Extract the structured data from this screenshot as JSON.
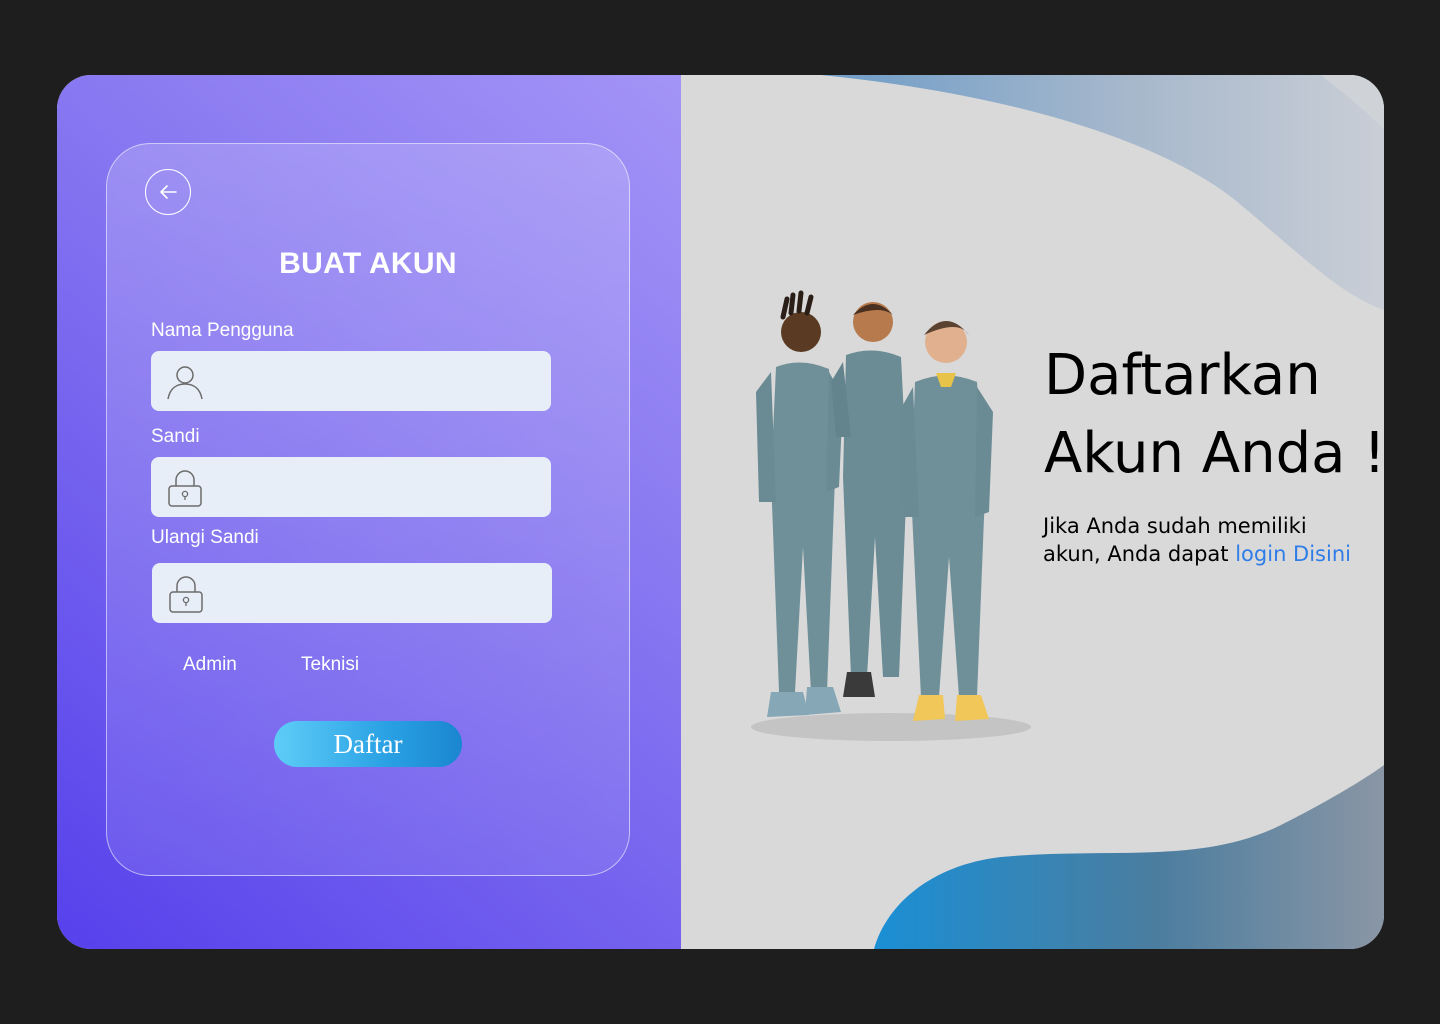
{
  "form": {
    "title": "BUAT AKUN",
    "back_icon": "arrow-left-icon",
    "fields": [
      {
        "label": "Nama Pengguna",
        "icon": "user-icon",
        "value": "",
        "placeholder": ""
      },
      {
        "label": "Sandi",
        "icon": "lock-icon",
        "value": "",
        "placeholder": ""
      },
      {
        "label": "Ulangi Sandi",
        "icon": "lock-icon",
        "value": "",
        "placeholder": ""
      }
    ],
    "roles": [
      "Admin",
      "Teknisi"
    ],
    "submit_label": "Daftar"
  },
  "hero": {
    "headline_line1": "Daftarkan",
    "headline_line2": "Akun Anda !",
    "subtext": "Jika Anda sudah memiliki",
    "subtext_line2": "akun, Anda dapat ",
    "login_link": "login Disini",
    "illustration": "three people in teal jumpsuits"
  },
  "colors": {
    "left_gradient_start": "#a394f7",
    "left_gradient_end": "#5640ec",
    "input_bg": "#e8eef7",
    "button_start": "#5ecdf7",
    "button_end": "#1a86d0",
    "link": "#2f7de8",
    "right_bg": "#d9d9d9"
  }
}
